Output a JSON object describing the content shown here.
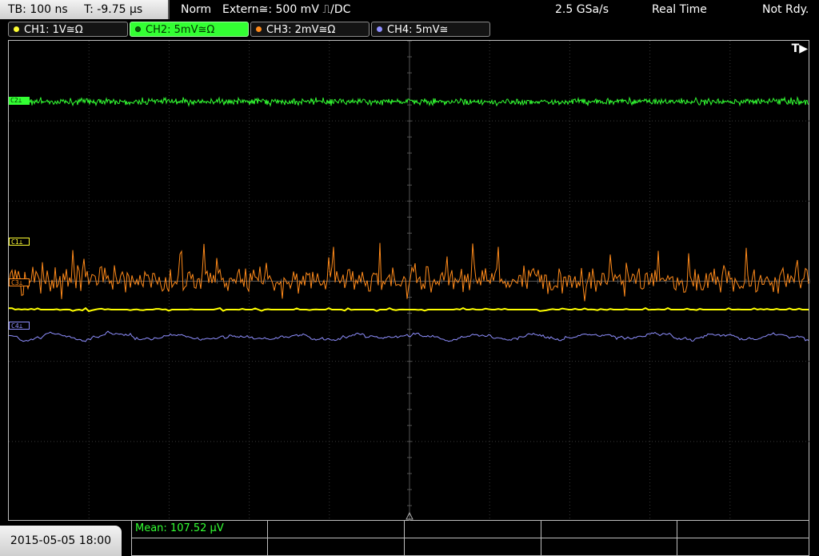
{
  "header": {
    "timebase": "TB: 100 ns",
    "trigger_time": "T: -9.75 µs",
    "mode": "Norm",
    "trigger_source": "Extern≅: 500 mV ⎍/DC",
    "sample_rate": "2.5 GSa/s",
    "acq_mode": "Real Time",
    "status": "Not Rdy."
  },
  "channels": [
    {
      "label": "CH1: 1V≅Ω",
      "color": "#ffff33"
    },
    {
      "label": "CH2: 5mV≅Ω",
      "color": "#33ff33"
    },
    {
      "label": "CH3: 2mV≅Ω",
      "color": "#ff8a1a"
    },
    {
      "label": "CH4: 5mV≅",
      "color": "#8f8fff"
    }
  ],
  "ref_labels": {
    "c1": "C1⊥",
    "c2": "C2⊥",
    "c3": "C3⊥",
    "c4": "C4⊥"
  },
  "trigger_marker": "T▶",
  "footer": {
    "datetime": "2015-05-05 18:00",
    "mean": "Mean: 107.52 µV"
  }
}
